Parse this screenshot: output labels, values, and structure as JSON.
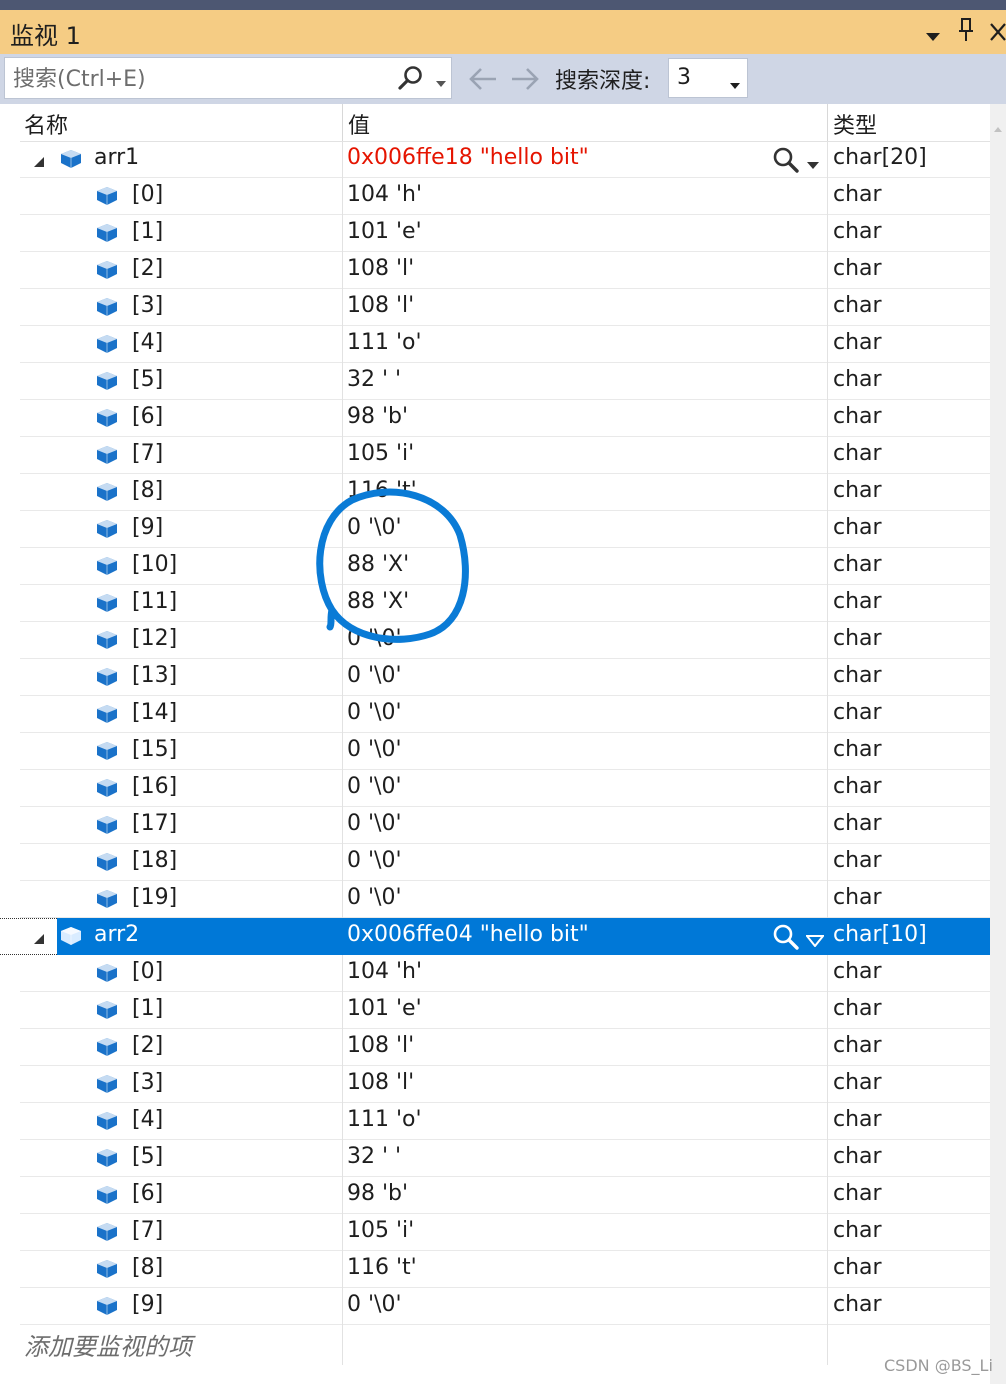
{
  "window": {
    "title": "监视 1",
    "controls": [
      "dropdown",
      "pin",
      "close"
    ],
    "title_bar_color": "#f5cc84"
  },
  "toolbar": {
    "search_placeholder": "搜索(Ctrl+E)",
    "depth_label": "搜索深度:",
    "depth_value": "3"
  },
  "columns": {
    "name": "名称",
    "value": "值",
    "type": "类型"
  },
  "variables": [
    {
      "name": "arr1",
      "value": "0x006ffe18 \"hello bit\"",
      "type": "char[20]",
      "expanded": true,
      "selected": false,
      "value_changed": true,
      "children": [
        {
          "name": "[0]",
          "value": "104 'h'",
          "type": "char"
        },
        {
          "name": "[1]",
          "value": "101 'e'",
          "type": "char"
        },
        {
          "name": "[2]",
          "value": "108 'l'",
          "type": "char"
        },
        {
          "name": "[3]",
          "value": "108 'l'",
          "type": "char"
        },
        {
          "name": "[4]",
          "value": "111 'o'",
          "type": "char"
        },
        {
          "name": "[5]",
          "value": "32 ' '",
          "type": "char"
        },
        {
          "name": "[6]",
          "value": "98 'b'",
          "type": "char"
        },
        {
          "name": "[7]",
          "value": "105 'i'",
          "type": "char"
        },
        {
          "name": "[8]",
          "value": "116 't'",
          "type": "char"
        },
        {
          "name": "[9]",
          "value": "0 '\\0'",
          "type": "char"
        },
        {
          "name": "[10]",
          "value": "88 'X'",
          "type": "char"
        },
        {
          "name": "[11]",
          "value": "88 'X'",
          "type": "char"
        },
        {
          "name": "[12]",
          "value": "0 '\\0'",
          "type": "char"
        },
        {
          "name": "[13]",
          "value": "0 '\\0'",
          "type": "char"
        },
        {
          "name": "[14]",
          "value": "0 '\\0'",
          "type": "char"
        },
        {
          "name": "[15]",
          "value": "0 '\\0'",
          "type": "char"
        },
        {
          "name": "[16]",
          "value": "0 '\\0'",
          "type": "char"
        },
        {
          "name": "[17]",
          "value": "0 '\\0'",
          "type": "char"
        },
        {
          "name": "[18]",
          "value": "0 '\\0'",
          "type": "char"
        },
        {
          "name": "[19]",
          "value": "0 '\\0'",
          "type": "char"
        }
      ]
    },
    {
      "name": "arr2",
      "value": "0x006ffe04 \"hello bit\"",
      "type": "char[10]",
      "expanded": true,
      "selected": true,
      "value_changed": false,
      "children": [
        {
          "name": "[0]",
          "value": "104 'h'",
          "type": "char"
        },
        {
          "name": "[1]",
          "value": "101 'e'",
          "type": "char"
        },
        {
          "name": "[2]",
          "value": "108 'l'",
          "type": "char"
        },
        {
          "name": "[3]",
          "value": "108 'l'",
          "type": "char"
        },
        {
          "name": "[4]",
          "value": "111 'o'",
          "type": "char"
        },
        {
          "name": "[5]",
          "value": "32 ' '",
          "type": "char"
        },
        {
          "name": "[6]",
          "value": "98 'b'",
          "type": "char"
        },
        {
          "name": "[7]",
          "value": "105 'i'",
          "type": "char"
        },
        {
          "name": "[8]",
          "value": "116 't'",
          "type": "char"
        },
        {
          "name": "[9]",
          "value": "0 '\\0'",
          "type": "char"
        }
      ]
    }
  ],
  "add_watch_placeholder": "添加要监视的项",
  "watermark": "CSDN @BS_Li",
  "colors": {
    "selection": "#0078d7",
    "changed_value": "#e51400",
    "annotation_circle": "#0a7bd6",
    "variable_icon": "#1a72c9"
  }
}
